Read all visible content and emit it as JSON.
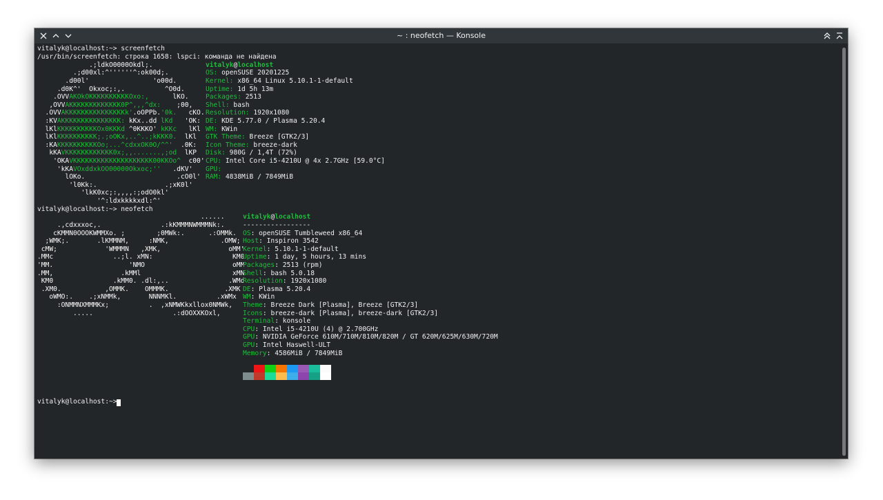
{
  "window": {
    "title": "~ : neofetch — Konsole",
    "icons": [
      "close-icon",
      "minimize-icon",
      "maximize-icon",
      "keep-above-icon",
      "keep-below-icon"
    ]
  },
  "colors": {
    "background": "#232629",
    "titlebar": "#31363b",
    "text": "#eff0f1",
    "accent_green": "#1ebd3c",
    "palette_top": [
      "#232629",
      "#ed1515",
      "#11d116",
      "#f67400",
      "#1d99f3",
      "#9b59b6",
      "#1abc9c",
      "#fcfcfc"
    ],
    "palette_bottom": [
      "#7f8c8d",
      "#c0392b",
      "#1cdc9a",
      "#fdbc4b",
      "#3daee9",
      "#8e44ad",
      "#16a085",
      "#ffffff"
    ]
  },
  "session1": {
    "prompt": "vitalyk@localhost:~>",
    "command": " screenfetch",
    "error": "/usr/bin/screenfetch: строка 1658: lspci: команда не найдена",
    "art": [
      "             .;ldkO0000Okdl;.",
      "         .;d00xl:^''''''^:ok00d;.",
      "       .d00l'                'o00d.",
      "     .d0K^'  Okxoc;:,.          ^O0d.",
      "    .OVV",
      "   ,OVV",
      "  .OVV",
      "  :KV",
      "  lKl",
      "  lKl",
      "  :KA",
      "   kKA",
      "    'OKA",
      "     'kKA",
      "       lOKo.                       .cO0l'",
      "        'l0Kk:.                 .;xK0l'",
      "           'lkK0xc;:,,,,:;odO0kl'",
      "               '^:ldxkkkkxdl:^'"
    ],
    "art_colored": [
      {
        "g": "AKOkOKKKKKKKKKKOxo:,",
        "w": "      lKO."
      },
      {
        "g": "AKKKKKKKKKKKKK0P^,,,^dx:",
        "w": "    ;00,"
      },
      {
        "g": "AKKKKKKKKKKKKKKKk'",
        "w": ".oOPPb.",
        "g2": "'0k.",
        "w2": "   cKO."
      },
      {
        "g": "AKKKKKKKKKKKKKKK:",
        "w": " kKx..dd",
        "g2": " lKd",
        "w2": "   'OK:"
      },
      {
        "g": "KKKKKKKKKKOx0KKKd",
        "w": " ^0KKKO'",
        "g2": " kKKc",
        "w2": "   lKl"
      },
      {
        "g": "KKKKKKKKKK;.;oOKx,..^..;kKKK0.",
        "w": "  lKl"
      },
      {
        "g": "KKKKKKKKKKOo;...^cdxxOK0O/^^'",
        "w": "  .0K:"
      },
      {
        "g": "VKKKKKKKKKKKK0x;,,.......,;od",
        "w": "  lKP"
      },
      {
        "g": "VKKKKKKKKKKKKKKKKKKKK00KKOo^",
        "w": "  c00'"
      },
      {
        "g": "VOxddxkOO00000Okxoc;''",
        "w": "   .dKV'"
      }
    ],
    "info": [
      {
        "label": "OS:",
        "value": " openSUSE 20201225"
      },
      {
        "label": "Kernel:",
        "value": " x86_64 Linux 5.10.1-1-default"
      },
      {
        "label": "Uptime:",
        "value": " 1d 5h 13m"
      },
      {
        "label": "Packages:",
        "value": " 2513"
      },
      {
        "label": "Shell:",
        "value": " bash"
      },
      {
        "label": "Resolution:",
        "value": " 1920x1080"
      },
      {
        "label": "DE:",
        "value": " KDE 5.77.0 / Plasma 5.20.4"
      },
      {
        "label": "WM:",
        "value": " KWin"
      },
      {
        "label": "GTK Theme:",
        "value": " Breeze [GTK2/3]"
      },
      {
        "label": "Icon Theme:",
        "value": " breeze-dark"
      },
      {
        "label": "Disk:",
        "value": " 980G / 1,4T (72%)"
      },
      {
        "label": "CPU:",
        "value": " Intel Core i5-4210U @ 4x 2.7GHz [59.0°C]"
      },
      {
        "label": "GPU:",
        "value": ""
      },
      {
        "label": "RAM:",
        "value": " 4838MiB / 7849MiB"
      }
    ],
    "user": "vitalyk",
    "at": "@",
    "host": "localhost"
  },
  "session2": {
    "prompt": "vitalyk@localhost:~>",
    "command": " neofetch",
    "art": [
      "                                         ......",
      "     .,cdxxxoc,.               .:kKMMMNWMMMNk:.",
      "    cKMMN0OOOKWMMXo. ;        ;0MWk:.      .:OMMk.",
      "  ;WMK;.       .lKMMNM,     :NMK,             .OMW;",
      " cMW;            'WMMMN   ,XMK,                 oMM'",
      ".MMc               ..;l. xMN:                    KM0",
      "'MM.                   'NMO                      oMM",
      ".MM,                 .kMMl                       xMN",
      " KM0               .kMM0. .dl:,..               .WMd",
      " .XM0.           ,OMMK.    OMMMK.              .XMK",
      "   oWMO:.    .;xNMMk,       NNNMKl.          .xWMx",
      "     :ONMMNXMMMKx;          .  ,xNMWKkxllox0NMWk,",
      "         .....                    .:dOOXXKOxl,"
    ],
    "user": "vitalyk",
    "at": "@",
    "host": "localhost",
    "separator": "-----------------",
    "info": [
      {
        "label": "OS",
        "value": ": openSUSE Tumbleweed x86_64"
      },
      {
        "label": "Host",
        "value": ": Inspiron 3542"
      },
      {
        "label": "Kernel",
        "value": ": 5.10.1-1-default"
      },
      {
        "label": "Uptime",
        "value": ": 1 day, 5 hours, 13 mins"
      },
      {
        "label": "Packages",
        "value": ": 2513 (rpm)"
      },
      {
        "label": "Shell",
        "value": ": bash 5.0.18"
      },
      {
        "label": "Resolution",
        "value": ": 1920x1080"
      },
      {
        "label": "DE",
        "value": ": Plasma 5.20.4"
      },
      {
        "label": "WM",
        "value": ": KWin"
      },
      {
        "label": "Theme",
        "value": ": Breeze Dark [Plasma], Breeze [GTK2/3]"
      },
      {
        "label": "Icons",
        "value": ": breeze-dark [Plasma], breeze-dark [GTK2/3]"
      },
      {
        "label": "Terminal",
        "value": ": konsole"
      },
      {
        "label": "CPU",
        "value": ": Intel i5-4210U (4) @ 2.700GHz"
      },
      {
        "label": "GPU",
        "value": ": NVIDIA GeForce 610M/710M/810M/820M / GT 620M/625M/630M/720M"
      },
      {
        "label": "GPU",
        "value": ": Intel Haswell-ULT"
      },
      {
        "label": "Memory",
        "value": ": 4586MiB / 7849MiB"
      }
    ]
  },
  "session3": {
    "prompt": "vitalyk@localhost:~>",
    "command": " "
  }
}
